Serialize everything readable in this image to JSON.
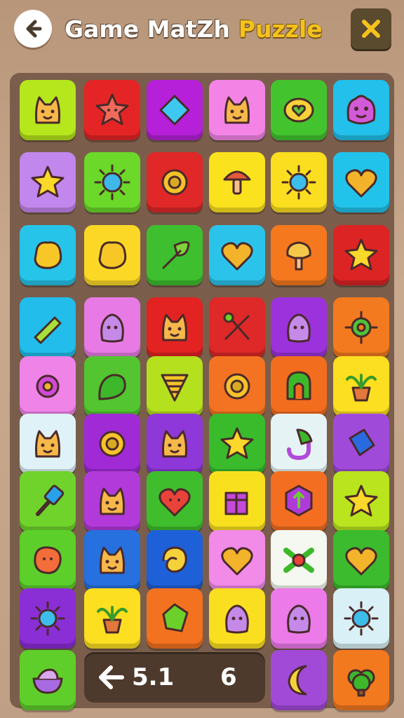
{
  "header": {
    "title_main": "Game MatZh",
    "title_accent": "Puzzle",
    "back_icon": "back-arrow-icon",
    "close_icon": "close-x-icon"
  },
  "status_bar": {
    "score": "5.1",
    "moves": "6",
    "icon": "left-arrow-icon"
  },
  "colors": {
    "board": "#7a5e4b",
    "title_accent": "#f4c21c",
    "close_button": "#5a4a2e"
  },
  "tiles": [
    {
      "row": 0,
      "col": 0,
      "color": "#b6e61c",
      "icon": "cat-face"
    },
    {
      "row": 0,
      "col": 1,
      "color": "#e52525",
      "icon": "star-face"
    },
    {
      "row": 0,
      "col": 2,
      "color": "#b520d8",
      "icon": "diamond"
    },
    {
      "row": 0,
      "col": 3,
      "color": "#f384e6",
      "icon": "cat-face"
    },
    {
      "row": 0,
      "col": 4,
      "color": "#43c42e",
      "icon": "heart-ring"
    },
    {
      "row": 0,
      "col": 5,
      "color": "#22c0ea",
      "icon": "monster-face"
    },
    {
      "row": 1,
      "col": 0,
      "color": "#c287ec",
      "icon": "star"
    },
    {
      "row": 1,
      "col": 1,
      "color": "#6bd82a",
      "icon": "sun-face"
    },
    {
      "row": 1,
      "col": 2,
      "color": "#e02828",
      "icon": "ring"
    },
    {
      "row": 1,
      "col": 3,
      "color": "#fbe21e",
      "icon": "mushroom"
    },
    {
      "row": 1,
      "col": 4,
      "color": "#fbde1f",
      "icon": "sun"
    },
    {
      "row": 1,
      "col": 5,
      "color": "#22c3ea",
      "icon": "heart"
    },
    {
      "row": 2,
      "col": 0,
      "color": "#27c4ea",
      "icon": "blob"
    },
    {
      "row": 2,
      "col": 1,
      "color": "#fcd826",
      "icon": "blob"
    },
    {
      "row": 2,
      "col": 2,
      "color": "#3ebf2f",
      "icon": "leaf"
    },
    {
      "row": 2,
      "col": 3,
      "color": "#2cc3eb",
      "icon": "heart"
    },
    {
      "row": 2,
      "col": 4,
      "color": "#f5781e",
      "icon": "tree"
    },
    {
      "row": 2,
      "col": 5,
      "color": "#dc2424",
      "icon": "star"
    },
    {
      "row": 3,
      "col": 0,
      "color": "#22bdea",
      "icon": "crayon"
    },
    {
      "row": 3,
      "col": 1,
      "color": "#e87ae6",
      "icon": "ghost"
    },
    {
      "row": 3,
      "col": 2,
      "color": "#e32222",
      "icon": "cat-face"
    },
    {
      "row": 3,
      "col": 3,
      "color": "#df2828",
      "icon": "tools"
    },
    {
      "row": 3,
      "col": 4,
      "color": "#9c32dc",
      "icon": "ghost"
    },
    {
      "row": 3,
      "col": 5,
      "color": "#f37a1f",
      "icon": "gear"
    },
    {
      "row": 4,
      "col": 0,
      "color": "#ef83e7",
      "icon": "flower"
    },
    {
      "row": 4,
      "col": 1,
      "color": "#52c530",
      "icon": "leaf-blob"
    },
    {
      "row": 4,
      "col": 2,
      "color": "#b4e01e",
      "icon": "cone"
    },
    {
      "row": 4,
      "col": 3,
      "color": "#f37322",
      "icon": "ring"
    },
    {
      "row": 4,
      "col": 4,
      "color": "#f36d1e",
      "icon": "arch"
    },
    {
      "row": 4,
      "col": 5,
      "color": "#fcdf20",
      "icon": "plant"
    },
    {
      "row": 5,
      "col": 0,
      "color": "#dff2f8",
      "icon": "cat-face"
    },
    {
      "row": 5,
      "col": 1,
      "color": "#a02ad5",
      "icon": "ring"
    },
    {
      "row": 5,
      "col": 2,
      "color": "#8e38d9",
      "icon": "cat-face"
    },
    {
      "row": 5,
      "col": 3,
      "color": "#39bb2c",
      "icon": "star"
    },
    {
      "row": 5,
      "col": 4,
      "color": "#e6f3f4",
      "icon": "magnet"
    },
    {
      "row": 5,
      "col": 5,
      "color": "#a04ada",
      "icon": "book"
    },
    {
      "row": 6,
      "col": 0,
      "color": "#6fd32b",
      "icon": "hammer"
    },
    {
      "row": 6,
      "col": 1,
      "color": "#b23adb",
      "icon": "cat-face"
    },
    {
      "row": 6,
      "col": 2,
      "color": "#3fbd2d",
      "icon": "heart-face"
    },
    {
      "row": 6,
      "col": 3,
      "color": "#f9e01f",
      "icon": "box"
    },
    {
      "row": 6,
      "col": 4,
      "color": "#f36e20",
      "icon": "hexagon"
    },
    {
      "row": 6,
      "col": 5,
      "color": "#b9e41e",
      "icon": "star"
    },
    {
      "row": 7,
      "col": 0,
      "color": "#5ccf2b",
      "icon": "blob-face"
    },
    {
      "row": 7,
      "col": 1,
      "color": "#2670e0",
      "icon": "cat-face"
    },
    {
      "row": 7,
      "col": 2,
      "color": "#1e60d8",
      "icon": "swirl"
    },
    {
      "row": 7,
      "col": 3,
      "color": "#f28ae8",
      "icon": "heart"
    },
    {
      "row": 7,
      "col": 4,
      "color": "#f5f8f0",
      "icon": "flower-leaf"
    },
    {
      "row": 7,
      "col": 5,
      "color": "#3bbb2d",
      "icon": "heart"
    },
    {
      "row": 8,
      "col": 0,
      "color": "#8a2ed6",
      "icon": "sun"
    },
    {
      "row": 8,
      "col": 1,
      "color": "#fcdf20",
      "icon": "plant"
    },
    {
      "row": 8,
      "col": 2,
      "color": "#f3721f",
      "icon": "gem"
    },
    {
      "row": 8,
      "col": 3,
      "color": "#fadf20",
      "icon": "ghost"
    },
    {
      "row": 8,
      "col": 4,
      "color": "#ec7ae8",
      "icon": "ghost"
    },
    {
      "row": 8,
      "col": 5,
      "color": "#d9f1f6",
      "icon": "sun"
    },
    {
      "row": 9,
      "col": 0,
      "color": "#5fce2b",
      "icon": "bowl"
    },
    {
      "row": 9,
      "col": 4,
      "color": "#a24ad8",
      "icon": "moon"
    },
    {
      "row": 9,
      "col": 5,
      "color": "#f3791f",
      "icon": "bush"
    }
  ]
}
